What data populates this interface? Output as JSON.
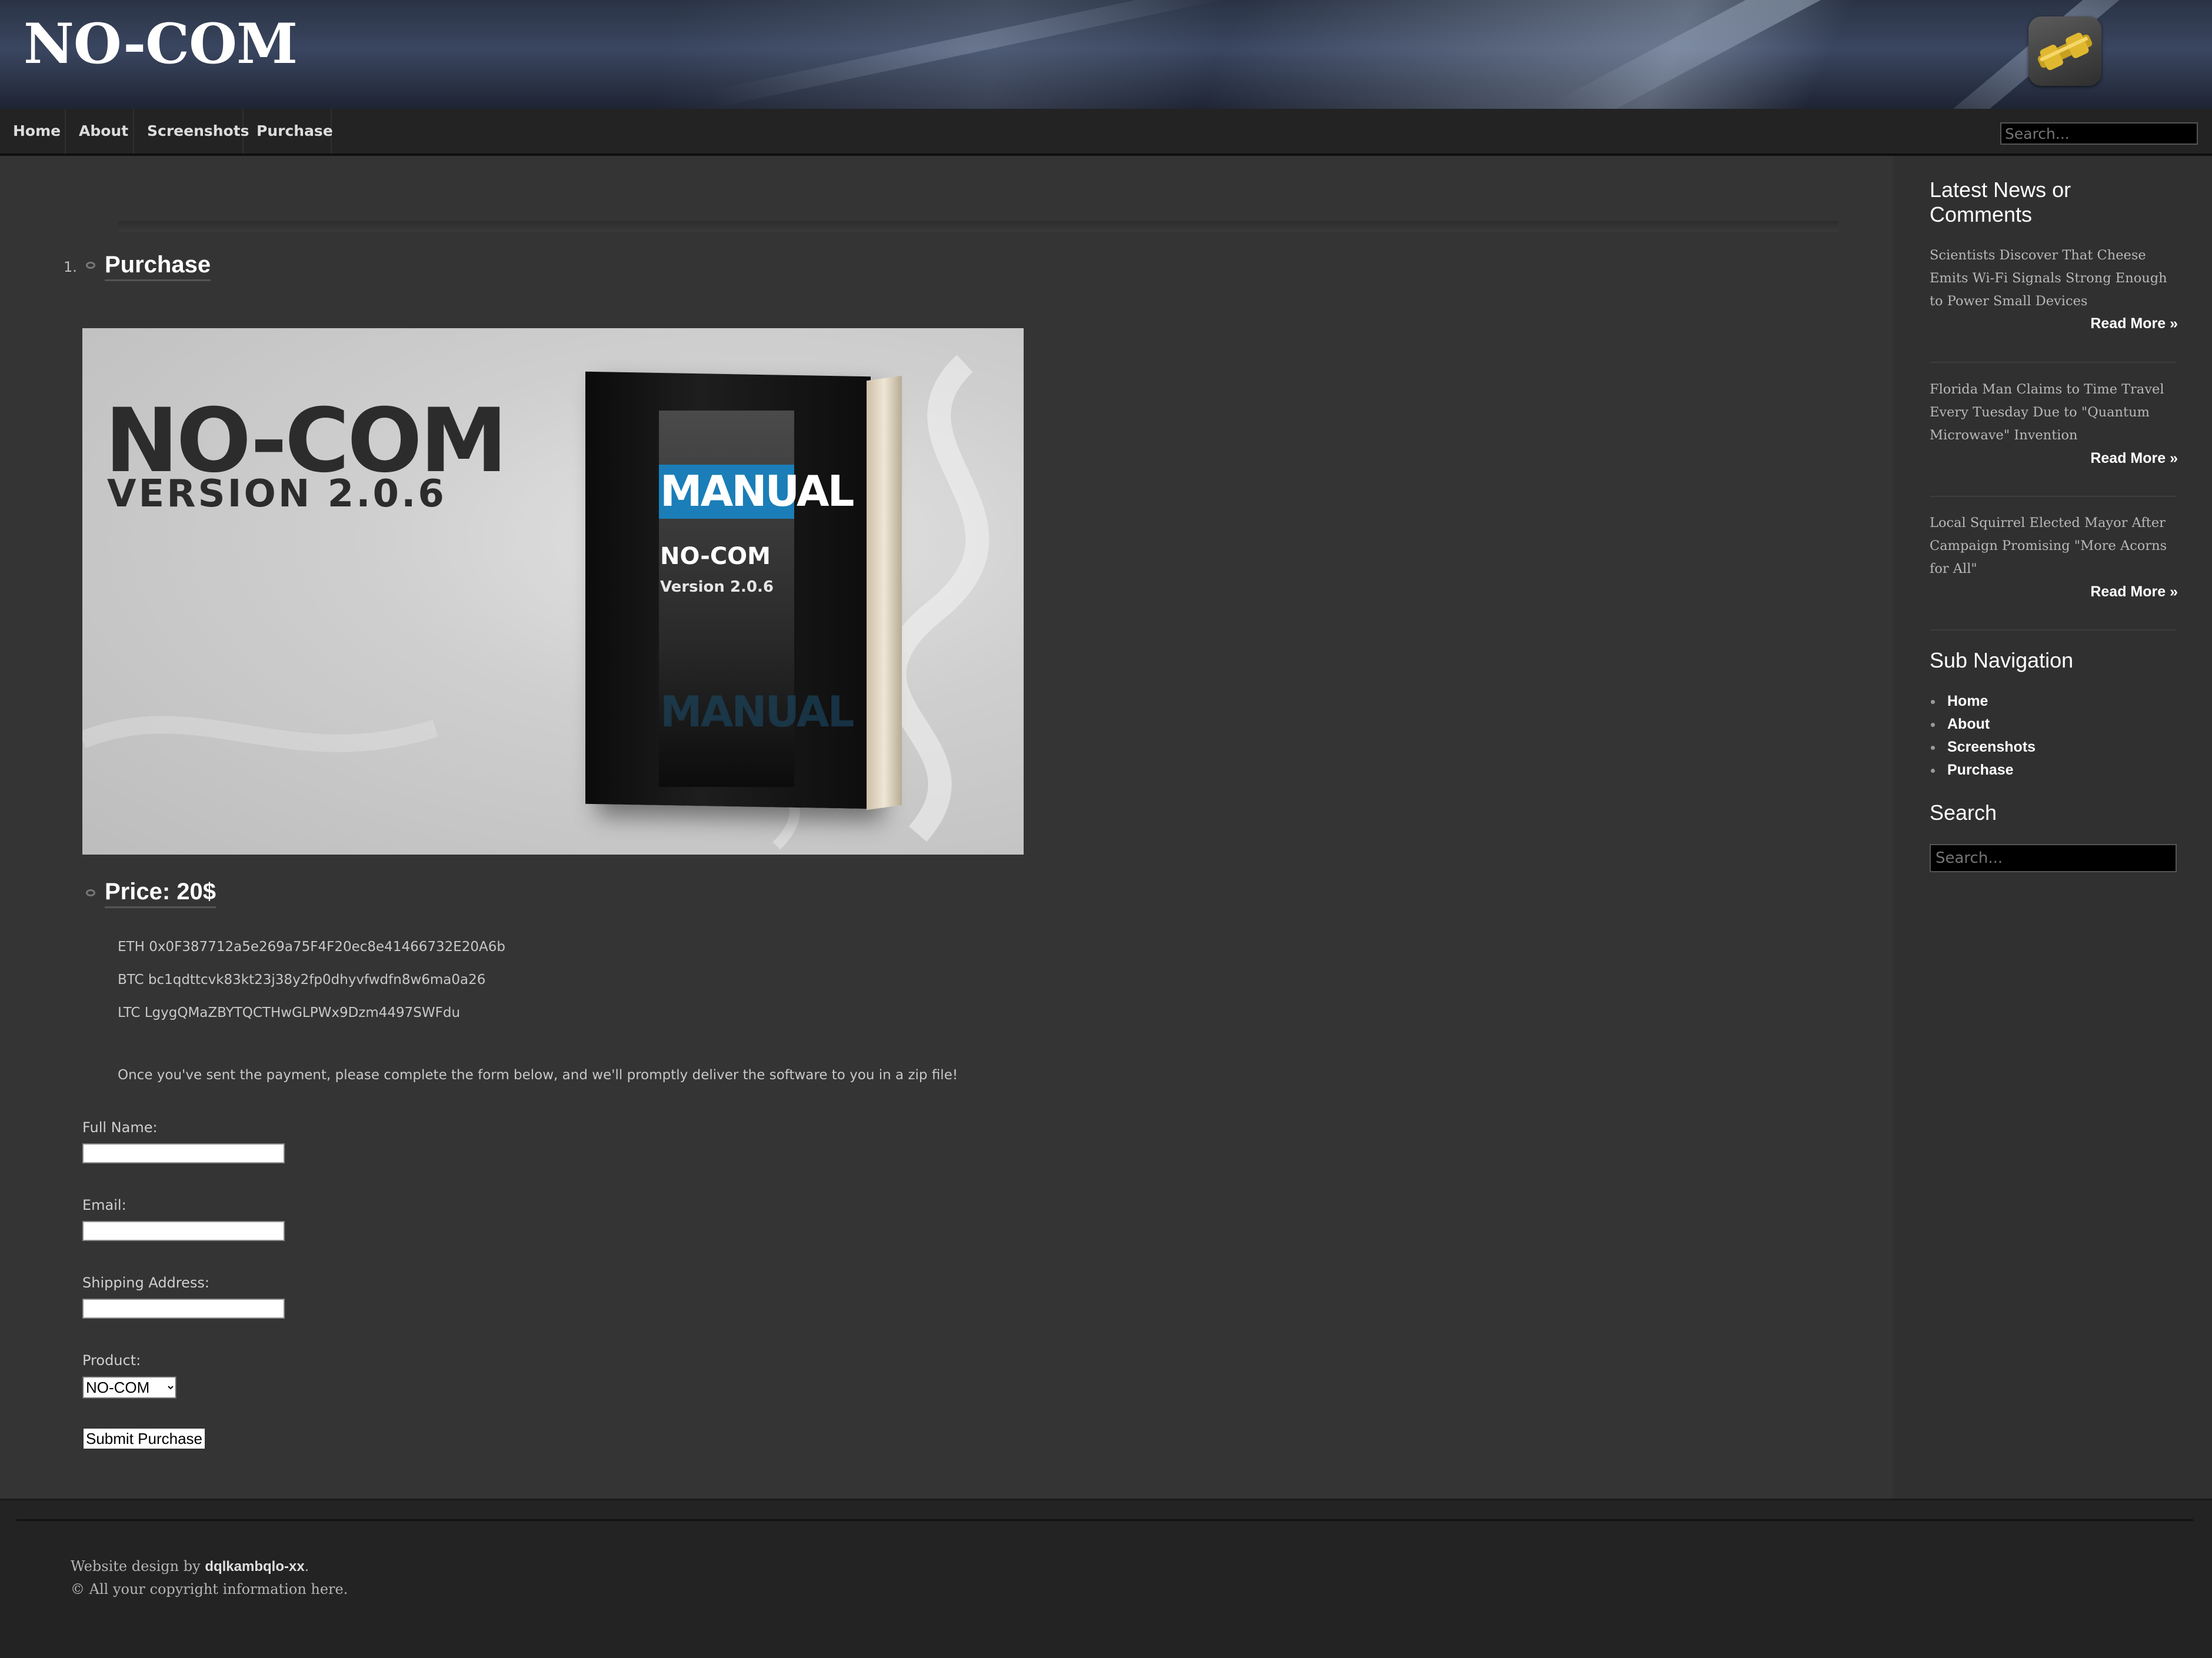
{
  "site": {
    "title": "NO-COM"
  },
  "nav": {
    "items": [
      {
        "label": "Home"
      },
      {
        "label": "About"
      },
      {
        "label": "Screenshots"
      },
      {
        "label": "Purchase"
      }
    ],
    "search_placeholder": "Search..."
  },
  "main": {
    "list_number": "1.",
    "page_heading": "Purchase",
    "image": {
      "title": "NO-COM",
      "version": "VERSION 2.0.6",
      "book_label": "MANUAL",
      "book_title": "NO-COM",
      "book_version": "Version 2.0.6"
    },
    "price_heading": "Price: 20$",
    "wallets": [
      "ETH 0x0F387712a5e269a75F4F20ec8e41466732E20A6b",
      "BTC bc1qdttcvk83kt23j38y2fp0dhyvfwdfn8w6ma0a26",
      "LTC LgygQMaZBYTQCTHwGLPWx9Dzm4497SWFdu"
    ],
    "instruction": "Once you've sent the payment, please complete the form below, and we'll promptly deliver the software to you in a zip file!",
    "form": {
      "full_name_label": "Full Name:",
      "email_label": "Email:",
      "shipping_label": "Shipping Address:",
      "product_label": "Product:",
      "product_selected": "NO-COM",
      "submit_label": "Submit Purchase"
    }
  },
  "sidebar": {
    "news_heading": "Latest News or Comments",
    "news": [
      {
        "text": "Scientists Discover That Cheese Emits Wi-Fi Signals Strong Enough to Power Small Devices",
        "link": "Read More »"
      },
      {
        "text": "Florida Man Claims to Time Travel Every Tuesday Due to \"Quantum Microwave\" Invention",
        "link": "Read More »"
      },
      {
        "text": "Local Squirrel Elected Mayor After Campaign Promising \"More Acorns for All\"",
        "link": "Read More »"
      }
    ],
    "subnav_heading": "Sub Navigation",
    "subnav": [
      {
        "label": "Home"
      },
      {
        "label": "About"
      },
      {
        "label": "Screenshots"
      },
      {
        "label": "Purchase"
      }
    ],
    "search_heading": "Search",
    "search_placeholder": "Search..."
  },
  "footer": {
    "design_prefix": "Website design by ",
    "author": "dqlkambqlo-xx",
    "design_suffix": ".",
    "copyright": "© All your copyright information here."
  }
}
